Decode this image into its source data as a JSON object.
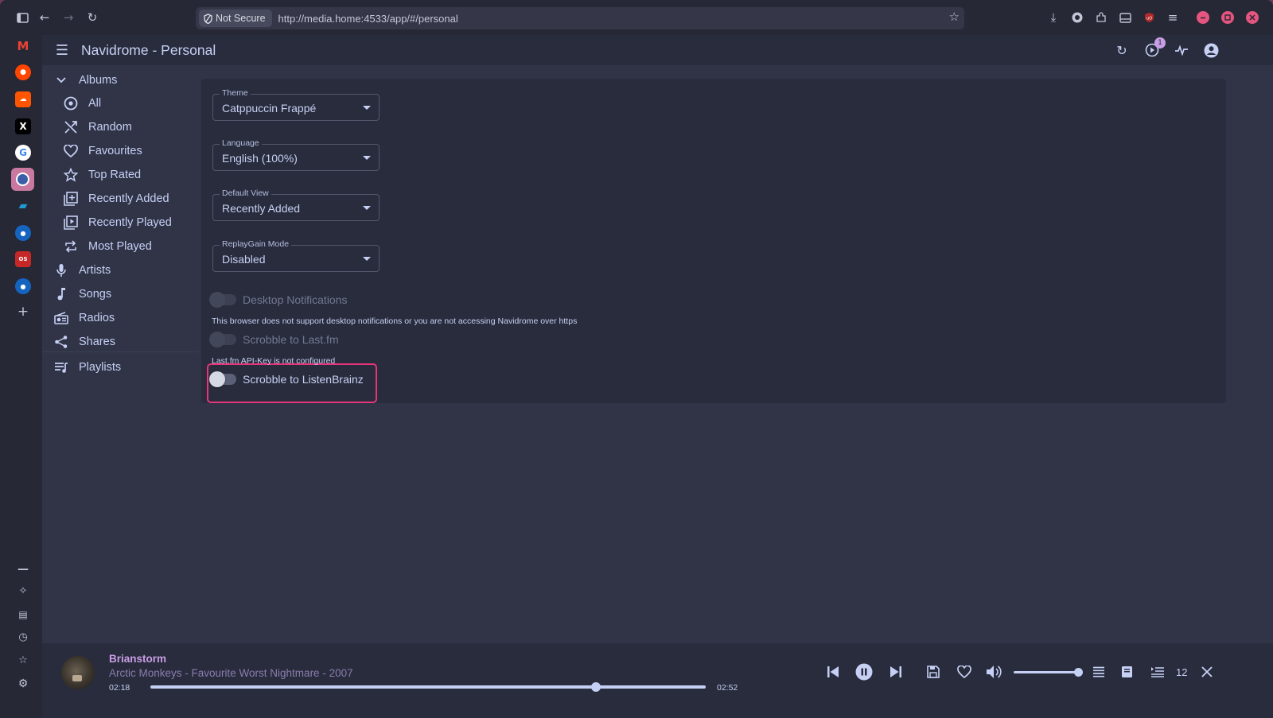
{
  "browser": {
    "not_secure_label": "Not Secure",
    "url": "http://media.home:4533/app/#/personal",
    "sidebar_items": [
      "gmail-icon",
      "reddit-icon",
      "soundcloud-icon",
      "x-icon",
      "google-icon",
      "navidrome-icon",
      "app-icon",
      "app-icon",
      "os-icon",
      "app-icon",
      "add-icon"
    ]
  },
  "app": {
    "title": "Navidrome - Personal",
    "queue_badge": "1"
  },
  "nav": {
    "albums": "Albums",
    "all": "All",
    "random": "Random",
    "favourites": "Favourites",
    "top_rated": "Top Rated",
    "recently_added": "Recently Added",
    "recently_played": "Recently Played",
    "most_played": "Most Played",
    "artists": "Artists",
    "songs": "Songs",
    "radios": "Radios",
    "shares": "Shares",
    "playlists": "Playlists"
  },
  "settings": {
    "theme": {
      "label": "Theme",
      "value": "Catppuccin Frappé"
    },
    "language": {
      "label": "Language",
      "value": "English (100%)"
    },
    "default_view": {
      "label": "Default View",
      "value": "Recently Added"
    },
    "replaygain": {
      "label": "ReplayGain Mode",
      "value": "Disabled"
    },
    "desktop_notifications": {
      "label": "Desktop Notifications",
      "helper": "This browser does not support desktop notifications or you are not accessing Navidrome over https",
      "enabled": false,
      "disabled": true
    },
    "scrobble_lastfm": {
      "label": "Scrobble to Last.fm",
      "helper": "Last.fm API-Key is not configured",
      "enabled": false,
      "disabled": true
    },
    "scrobble_listenbrainz": {
      "label": "Scrobble to ListenBrainz",
      "enabled": false,
      "disabled": false
    }
  },
  "player": {
    "title": "Brianstorm",
    "subtitle": "Arctic Monkeys - Favourite Worst Nightmare - 2007",
    "current_time": "02:18",
    "duration": "02:52",
    "progress": 0.802,
    "volume": 1.0,
    "queue_count": "12"
  },
  "colors": {
    "accent": "#ca9ee6",
    "highlight_border": "#e8357a",
    "background": "#303446"
  }
}
